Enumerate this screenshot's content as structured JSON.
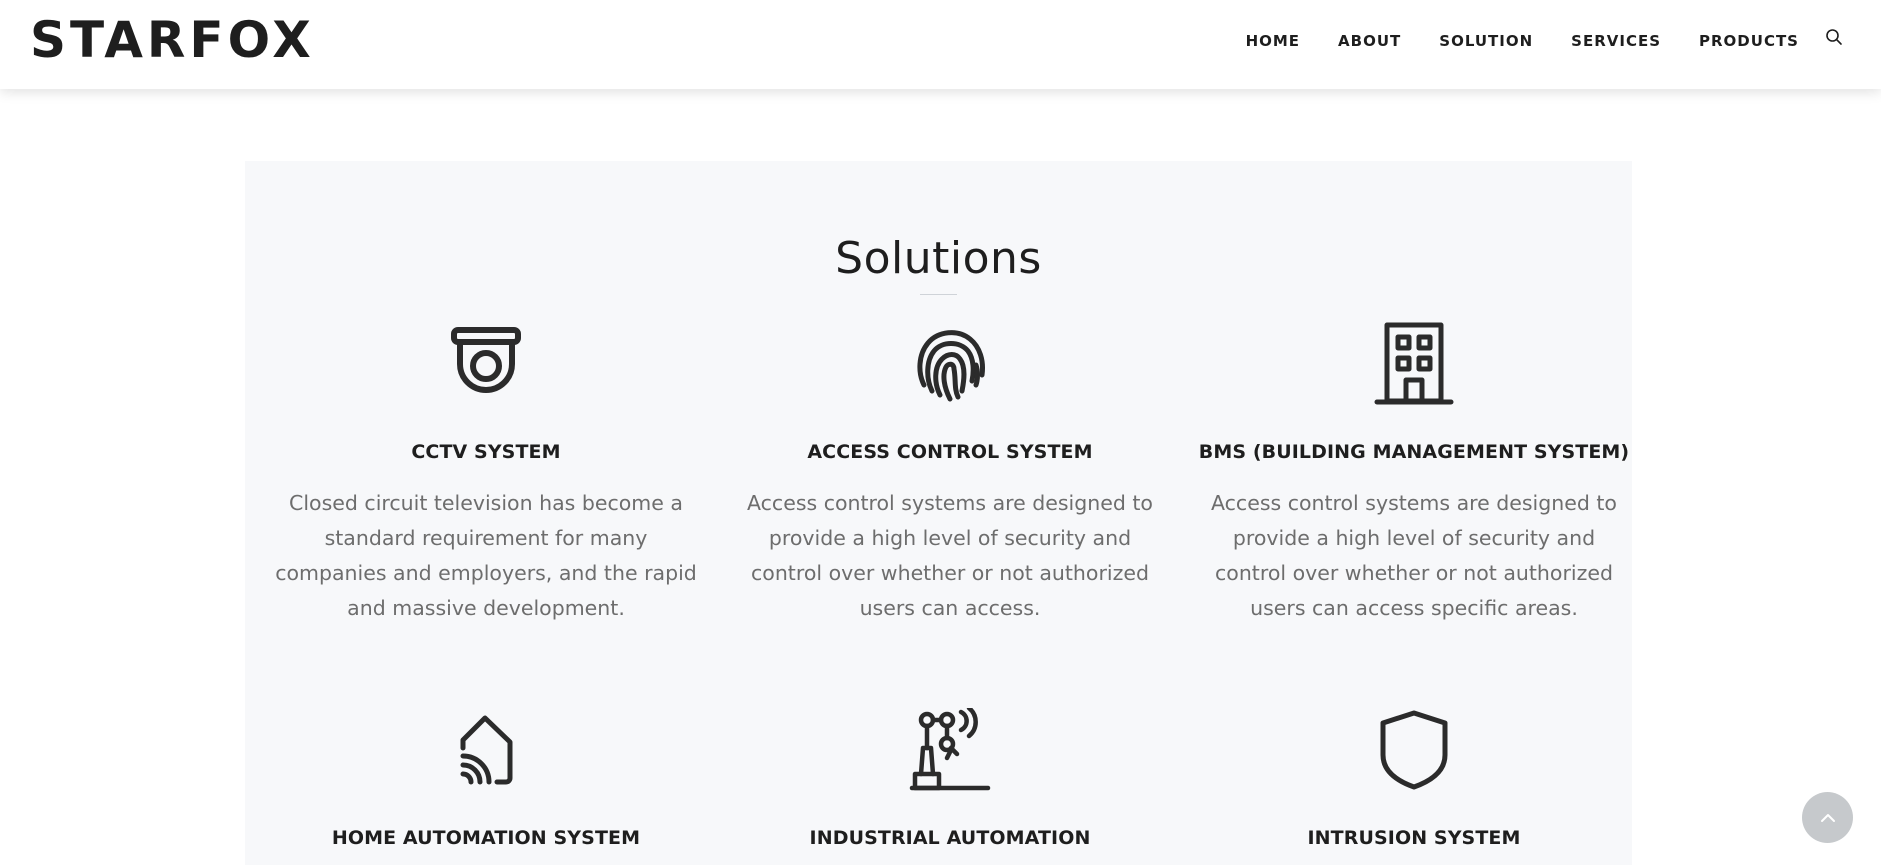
{
  "brand": {
    "logo_text": "STARFOX"
  },
  "nav": {
    "items": [
      "HOME",
      "ABOUT",
      "SOLUTION",
      "SERVICES",
      "PRODUCTS"
    ],
    "search_icon": "search-icon"
  },
  "solutions": {
    "title": "Solutions",
    "cards": [
      {
        "icon": "cctv-camera-icon",
        "title": "CCTV SYSTEM",
        "text": "Closed circuit television has become a standard requirement for many companies and employers, and the rapid and massive development."
      },
      {
        "icon": "fingerprint-icon",
        "title": "ACCESS CONTROL SYSTEM",
        "text": "Access control systems are designed to provide a high level of security and control over whether or not authorized users can access."
      },
      {
        "icon": "building-icon",
        "title": "BMS (BUILDING MANAGEMENT SYSTEM)",
        "text": "Access control systems are designed to provide a high level of security and control over whether or not authorized users can access specific areas."
      },
      {
        "icon": "smart-home-icon",
        "title": "HOME AUTOMATION SYSTEM",
        "text": ""
      },
      {
        "icon": "robotic-arm-icon",
        "title": "INDUSTRIAL AUTOMATION",
        "text": ""
      },
      {
        "icon": "shield-icon",
        "title": "INTRUSION SYSTEM",
        "text": ""
      }
    ]
  },
  "back_to_top": {
    "icon": "chevron-up-icon"
  }
}
